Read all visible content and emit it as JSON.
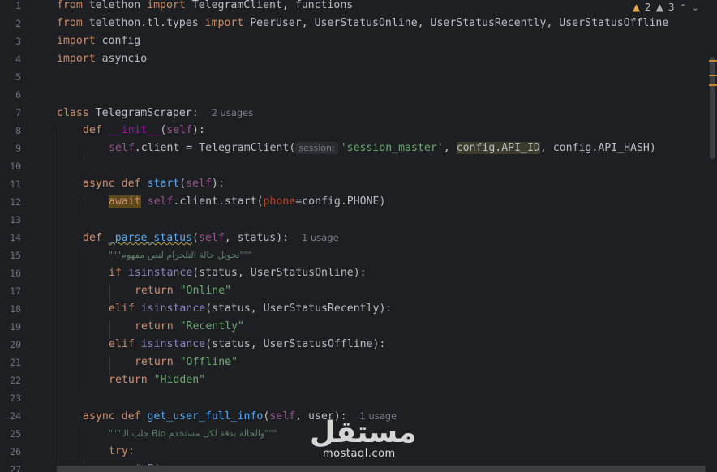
{
  "inspections": {
    "warnings_count": "2",
    "weak_warnings_count": "3"
  },
  "gutter": {
    "line_numbers": [
      "1",
      "2",
      "3",
      "4",
      "5",
      "6",
      "7",
      "8",
      "9",
      "10",
      "11",
      "12",
      "13",
      "14",
      "15",
      "16",
      "17",
      "18",
      "19",
      "20",
      "21",
      "22",
      "23",
      "24",
      "25",
      "26",
      "27"
    ]
  },
  "code": {
    "line1": {
      "kw_from": "from",
      "mod": " telethon ",
      "kw_import": "import",
      "names": " TelegramClient, functions"
    },
    "line2": {
      "kw_from": "from",
      "mod": " telethon.tl.types ",
      "kw_import": "import",
      "names": " PeerUser, UserStatusOnline, UserStatusRecently, UserStatusOffline"
    },
    "line3": {
      "kw_import": "import",
      "name": " config"
    },
    "line4": {
      "kw_import": "import",
      "name": " asyncio"
    },
    "line7": {
      "kw_class": "class",
      "name": " TelegramScraper:",
      "usages": "2 usages"
    },
    "line8": {
      "kw_def": "def",
      "fn": "__init__",
      "open": "(",
      "self": "self",
      "close": "):"
    },
    "line9": {
      "self": "self",
      "assign": ".client = TelegramClient(",
      "inlay": "session:",
      "str": "'session_master'",
      "comma": ", ",
      "hl": "config.API_ID",
      "rest": ", config.API_HASH)"
    },
    "line11": {
      "kw_async": "async",
      "kw_def": "def",
      "fn": "start",
      "open": "(",
      "self": "self",
      "close": "):"
    },
    "line12": {
      "kw_await": "await",
      "self": "self",
      "call": ".client.start(",
      "param": "phone",
      "rest": "=config.PHONE)"
    },
    "line14": {
      "kw_def": "def",
      "fn": "_parse_status",
      "open": "(",
      "self": "self",
      "args": ", status):",
      "usages": "1 usage"
    },
    "line15": {
      "doc": "\"\"\"تحويل حالة التلجرام لنص مفهوم\"\"\""
    },
    "line16": {
      "kw_if": "if",
      "builtin": "isinstance",
      "args": "(status, UserStatusOnline):"
    },
    "line17": {
      "kw_return": "return",
      "str": "\"Online\""
    },
    "line18": {
      "kw_elif": "elif",
      "builtin": "isinstance",
      "args": "(status, UserStatusRecently):"
    },
    "line19": {
      "kw_return": "return",
      "str": "\"Recently\""
    },
    "line20": {
      "kw_elif": "elif",
      "builtin": "isinstance",
      "args": "(status, UserStatusOffline):"
    },
    "line21": {
      "kw_return": "return",
      "str": "\"Offline\""
    },
    "line22": {
      "kw_return": "return",
      "str": "\"Hidden\""
    },
    "line24": {
      "kw_async": "async",
      "kw_def": "def",
      "fn": "get_user_full_info",
      "open": "(",
      "self": "self",
      "args": ", user):",
      "usages": "1 usage"
    },
    "line25": {
      "doc": "\"\"\"جلب الـ Bio والحالة بدقة لكل مستخدم\"\"\""
    },
    "line26": {
      "kw_try": "try:"
    },
    "line27": {
      "comment": "# Bio ..."
    }
  },
  "watermark": {
    "arabic": "مستقل",
    "latin": "mostaql.com"
  },
  "colors": {
    "background": "#1e1f22",
    "keyword": "#cf8e6d",
    "function": "#56a8f5",
    "string": "#6aab73",
    "self": "#94558d",
    "warning": "#e0a94b"
  }
}
